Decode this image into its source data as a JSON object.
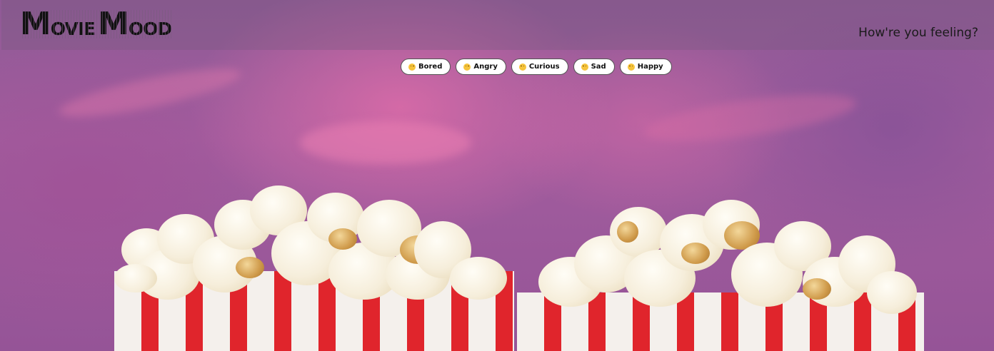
{
  "header": {
    "logo": {
      "part1_big": "M",
      "part1_small": "OVIE",
      "part2_big": "M",
      "part2_small": "OOD"
    },
    "tagline": "How're you feeling?"
  },
  "moods": [
    {
      "label": "Bored",
      "icon": "unamused-face-icon"
    },
    {
      "label": "Angry",
      "icon": "angry-face-icon"
    },
    {
      "label": "Curious",
      "icon": "thinking-face-icon"
    },
    {
      "label": "Sad",
      "icon": "sad-face-icon"
    },
    {
      "label": "Happy",
      "icon": "happy-face-icon"
    }
  ],
  "colors": {
    "background_purple": "#a25d9e",
    "bucket_red": "#e0252c",
    "bucket_white": "#f4f0ec",
    "emoji_yellow": "#f6c43c"
  }
}
